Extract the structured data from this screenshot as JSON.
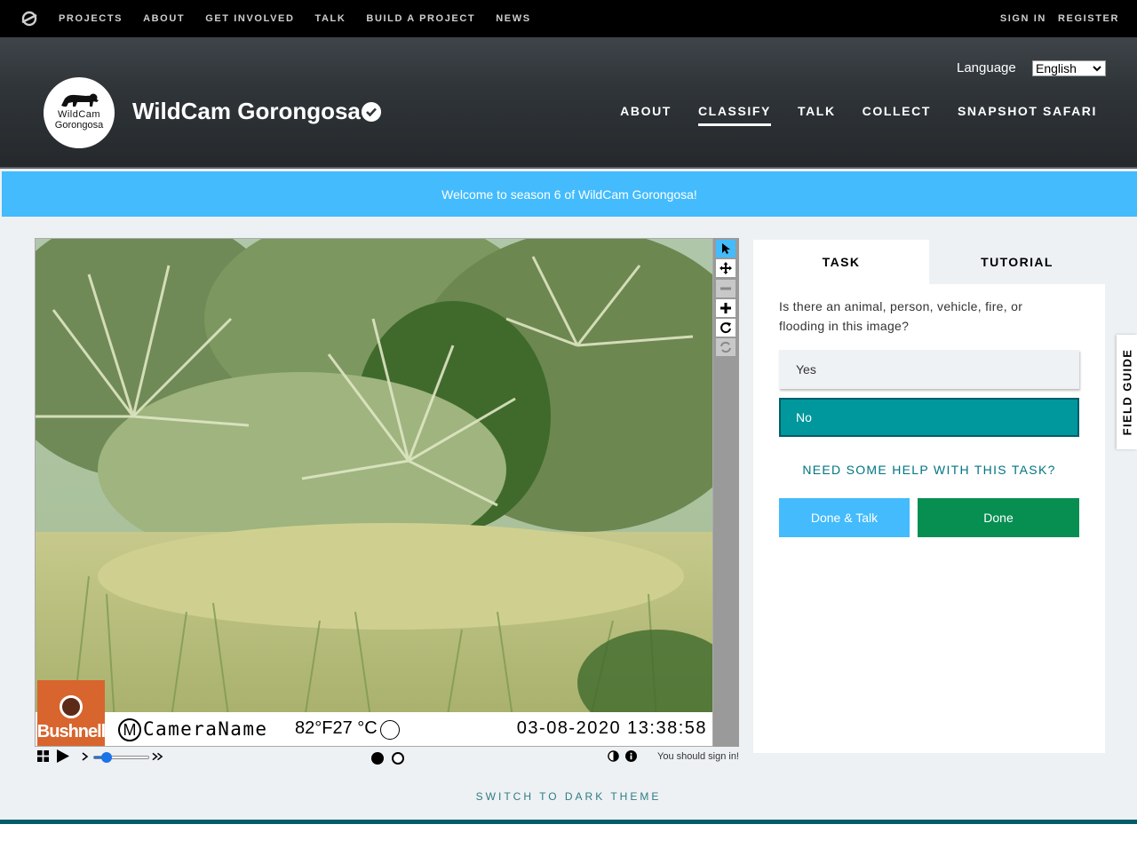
{
  "topnav": {
    "links": [
      "PROJECTS",
      "ABOUT",
      "GET INVOLVED",
      "TALK",
      "BUILD A PROJECT",
      "NEWS"
    ],
    "sign_in": "SIGN IN",
    "register": "REGISTER"
  },
  "project": {
    "title": "WildCam Gorongosa",
    "avatar_line1": "WildCam",
    "avatar_line2": "Gorongosa",
    "language_label": "Language",
    "language_value": "English",
    "nav": [
      "ABOUT",
      "CLASSIFY",
      "TALK",
      "COLLECT",
      "SNAPSHOT SAFARI"
    ],
    "active_nav": "CLASSIFY"
  },
  "announcement": "Welcome to season 6 of WildCam Gorongosa!",
  "subject": {
    "camera_brand": "Bushnell",
    "camera_name": "CameraName",
    "temperature": "82°F27 °C",
    "datetime": "03-08-2020 13:38:58"
  },
  "viewer": {
    "tools": [
      "pointer-icon",
      "pan-icon",
      "zoom-out-icon",
      "zoom-in-icon",
      "rotate-icon",
      "reset-icon"
    ],
    "signin_hint": "You should sign in!"
  },
  "task": {
    "tabs": [
      "TASK",
      "TUTORIAL"
    ],
    "question": "Is there an animal, person, vehicle, fire, or flooding in this image?",
    "answers": [
      "Yes",
      "No"
    ],
    "selected": "No",
    "help": "NEED SOME HELP WITH THIS TASK?",
    "done_talk": "Done & Talk",
    "done": "Done"
  },
  "field_guide": "FIELD GUIDE",
  "dark_theme": "SWITCH TO DARK THEME",
  "colors": {
    "announcement": "#43bbfd",
    "selected_answer": "#00979d",
    "done_button": "#078f52",
    "done_talk_button": "#43bbfd",
    "accent_teal": "#005d69"
  }
}
